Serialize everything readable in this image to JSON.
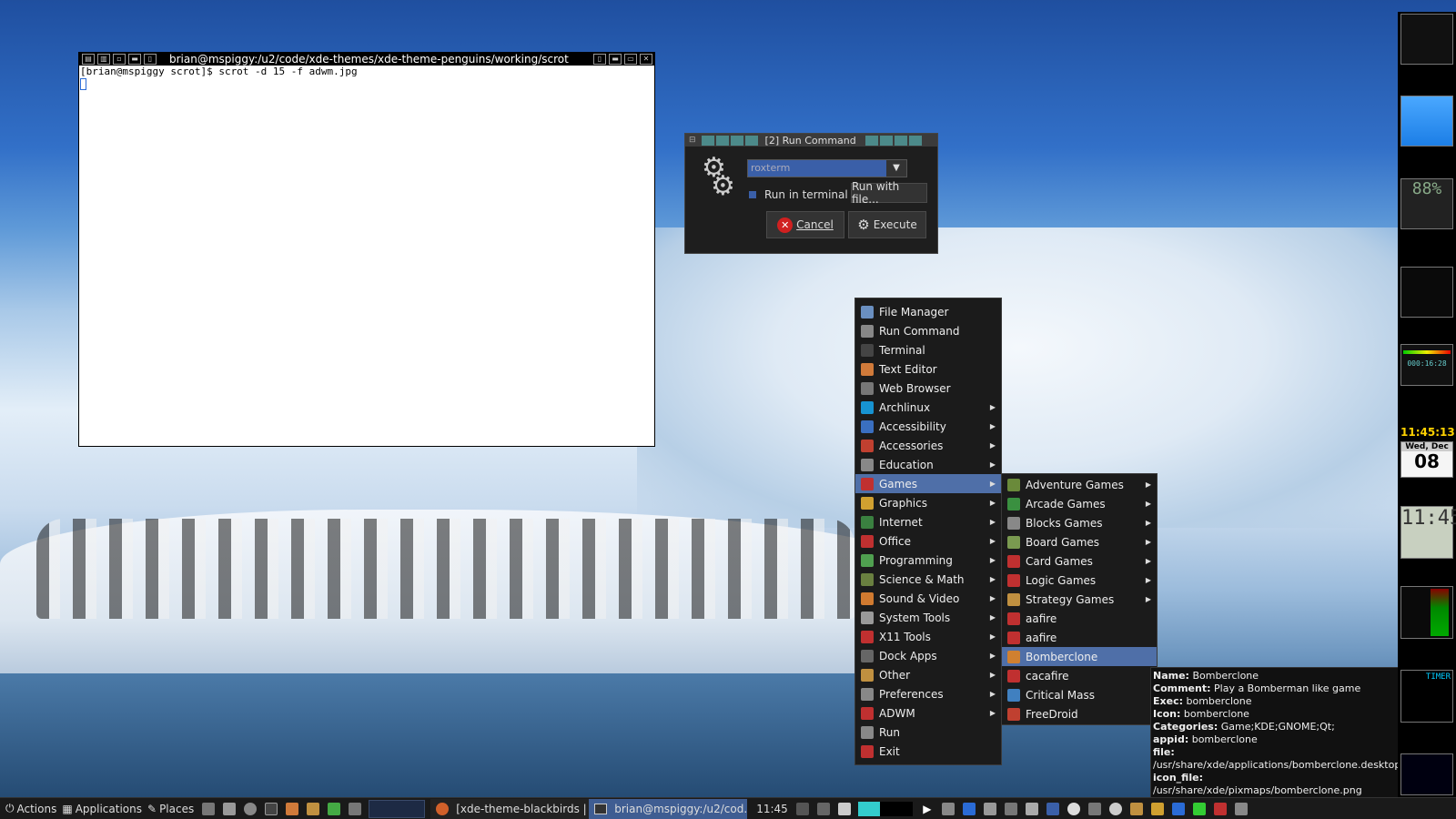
{
  "terminal": {
    "title": "brian@mspiggy:/u2/code/xde-themes/xde-theme-penguins/working/scrot",
    "line": "[brian@mspiggy scrot]$ scrot -d 15 -f adwm.jpg"
  },
  "run_dialog": {
    "title": "[2] Run Command",
    "command_value": "roxterm",
    "run_in_terminal": "Run in terminal",
    "run_with_file": "Run with file...",
    "cancel": "Cancel",
    "execute": "Execute"
  },
  "main_menu": [
    {
      "label": "File Manager",
      "icon": "folder-icon",
      "color": "#6a8fc0",
      "sub": false
    },
    {
      "label": "Run Command",
      "icon": "gear-icon",
      "color": "#888",
      "sub": false
    },
    {
      "label": "Terminal",
      "icon": "terminal-icon",
      "color": "#444",
      "sub": false
    },
    {
      "label": "Text Editor",
      "icon": "text-editor-icon",
      "color": "#d07a3a",
      "sub": false
    },
    {
      "label": "Web Browser",
      "icon": "globe-icon",
      "color": "#777",
      "sub": false
    },
    {
      "label": "Archlinux",
      "icon": "arch-icon",
      "color": "#1793d1",
      "sub": true
    },
    {
      "label": "Accessibility",
      "icon": "accessibility-icon",
      "color": "#3a6fc0",
      "sub": true
    },
    {
      "label": "Accessories",
      "icon": "accessories-icon",
      "color": "#c04030",
      "sub": true
    },
    {
      "label": "Education",
      "icon": "education-icon",
      "color": "#888",
      "sub": true
    },
    {
      "label": "Games",
      "icon": "games-icon",
      "color": "#c03030",
      "sub": true
    },
    {
      "label": "Graphics",
      "icon": "graphics-icon",
      "color": "#d0a030",
      "sub": true
    },
    {
      "label": "Internet",
      "icon": "internet-icon",
      "color": "#3a8040",
      "sub": true
    },
    {
      "label": "Office",
      "icon": "office-icon",
      "color": "#c03030",
      "sub": true
    },
    {
      "label": "Programming",
      "icon": "programming-icon",
      "color": "#50a050",
      "sub": true
    },
    {
      "label": "Science & Math",
      "icon": "science-icon",
      "color": "#6a8040",
      "sub": true
    },
    {
      "label": "Sound & Video",
      "icon": "sound-video-icon",
      "color": "#d07a30",
      "sub": true
    },
    {
      "label": "System Tools",
      "icon": "system-tools-icon",
      "color": "#999",
      "sub": true
    },
    {
      "label": "X11 Tools",
      "icon": "x11-icon",
      "color": "#c03030",
      "sub": true
    },
    {
      "label": "Dock Apps",
      "icon": "dock-apps-icon",
      "color": "#666",
      "sub": true
    },
    {
      "label": "Other",
      "icon": "other-icon",
      "color": "#c09040",
      "sub": true
    },
    {
      "label": "Preferences",
      "icon": "preferences-icon",
      "color": "#888",
      "sub": true
    },
    {
      "label": "ADWM",
      "icon": "adwm-icon",
      "color": "#c03030",
      "sub": true
    },
    {
      "label": "Run",
      "icon": "run-icon",
      "color": "#888",
      "sub": false
    },
    {
      "label": "Exit",
      "icon": "exit-icon",
      "color": "#c03030",
      "sub": false
    }
  ],
  "games_menu": [
    {
      "label": "Adventure Games",
      "icon": "adventure-icon",
      "color": "#6a8a3a",
      "sub": true
    },
    {
      "label": "Arcade Games",
      "icon": "arcade-icon",
      "color": "#3a9040",
      "sub": true
    },
    {
      "label": "Blocks Games",
      "icon": "blocks-icon",
      "color": "#888",
      "sub": true
    },
    {
      "label": "Board Games",
      "icon": "board-icon",
      "color": "#7a9a50",
      "sub": true
    },
    {
      "label": "Card Games",
      "icon": "card-icon",
      "color": "#c03030",
      "sub": true
    },
    {
      "label": "Logic Games",
      "icon": "logic-icon",
      "color": "#c03030",
      "sub": true
    },
    {
      "label": "Strategy Games",
      "icon": "strategy-icon",
      "color": "#c09040",
      "sub": true
    },
    {
      "label": "aafire",
      "icon": "aafire-icon",
      "color": "#c03030",
      "sub": false
    },
    {
      "label": "aafire",
      "icon": "aafire-icon",
      "color": "#c03030",
      "sub": false
    },
    {
      "label": "Bomberclone",
      "icon": "bomberclone-icon",
      "color": "#d08030",
      "sub": false
    },
    {
      "label": "cacafire",
      "icon": "cacafire-icon",
      "color": "#c03030",
      "sub": false
    },
    {
      "label": "Critical Mass",
      "icon": "critical-mass-icon",
      "color": "#4080c0",
      "sub": false
    },
    {
      "label": "FreeDroid",
      "icon": "freedroid-icon",
      "color": "#c04030",
      "sub": false
    }
  ],
  "games_selected_index": 9,
  "main_selected_index": 9,
  "tooltip": [
    {
      "k": "Name:",
      "v": "Bomberclone"
    },
    {
      "k": "Comment:",
      "v": "Play a Bomberman like game"
    },
    {
      "k": "Exec:",
      "v": "bomberclone"
    },
    {
      "k": "Icon:",
      "v": "bomberclone"
    },
    {
      "k": "Categories:",
      "v": "Game;KDE;GNOME;Qt;"
    },
    {
      "k": "appid:",
      "v": "bomberclone"
    },
    {
      "k": "file:",
      "v": "/usr/share/xde/applications/bomberclone.desktop"
    },
    {
      "k": "icon_file:",
      "v": "/usr/share/xde/pixmaps/bomberclone.png"
    }
  ],
  "dock": {
    "time": "11:45:13",
    "day": "Wed, Dec",
    "date": "08",
    "timer": "000:16:28",
    "timer_label": "TIMER"
  },
  "taskbar": {
    "actions": "Actions",
    "applications": "Applications",
    "places": "Places",
    "task1": "[xde-theme-blackbirds | ...",
    "task2": "brian@mspiggy:/u2/cod...",
    "clock": "11:45"
  },
  "colors": {
    "selection": "#4f6fa8",
    "menu_bg": "#1b1b1b",
    "panel_bg": "#1a1a1a"
  }
}
